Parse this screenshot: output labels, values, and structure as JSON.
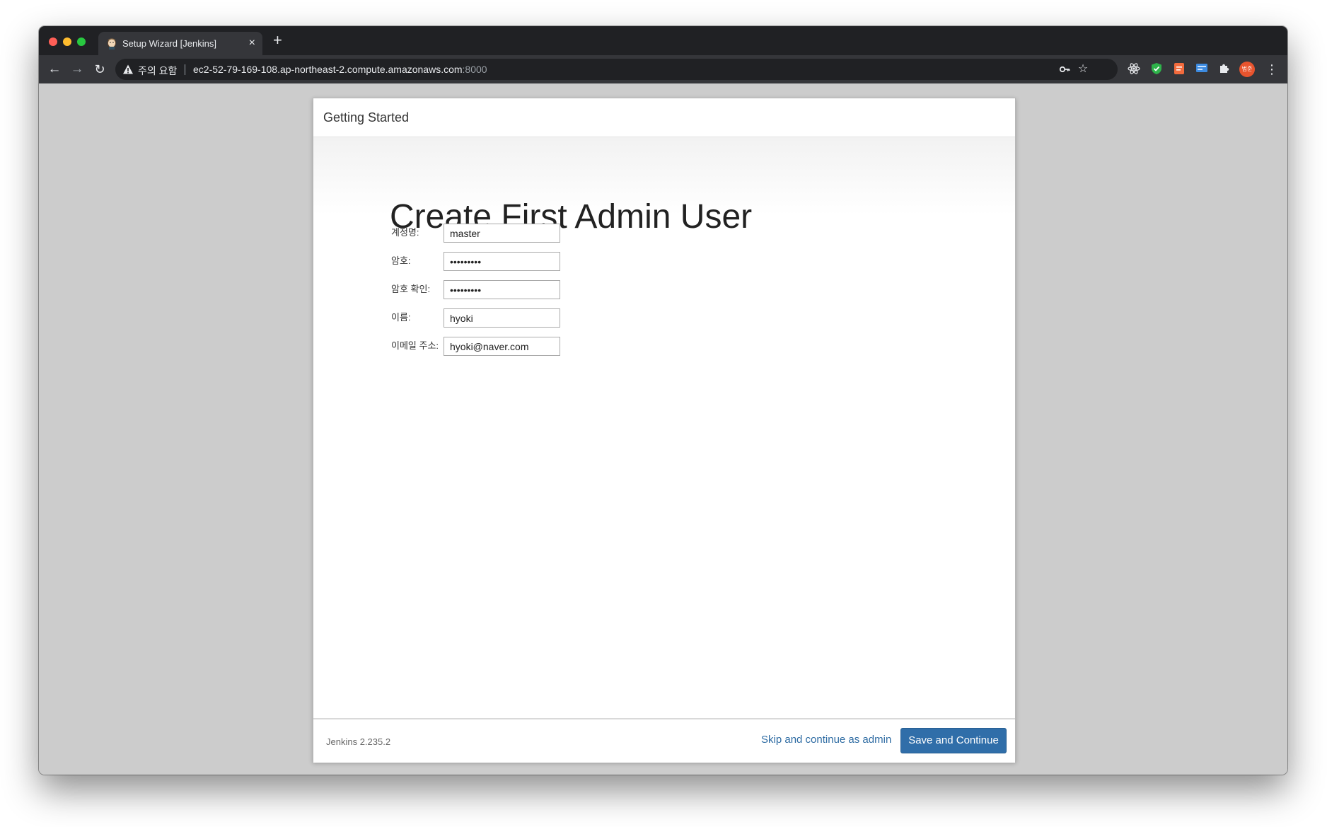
{
  "browser": {
    "tab": {
      "title": "Setup Wizard [Jenkins]",
      "close_glyph": "×"
    },
    "new_tab_glyph": "+",
    "nav": {
      "back_glyph": "←",
      "forward_glyph": "→",
      "reload_glyph": "↻"
    },
    "security_warning": "주의 요함",
    "url_host": "ec2-52-79-169-108.ap-northeast-2.compute.amazonaws.com",
    "url_port": ":8000",
    "profile_avatar_text": "범준",
    "icons": [
      "key-icon",
      "star-icon",
      "react-devtools-icon",
      "shield-check-icon",
      "ext-pdf-icon",
      "ext-card-icon",
      "puzzle-icon",
      "kebab-menu-icon"
    ]
  },
  "dialog": {
    "header_title": "Getting Started",
    "heading": "Create First Admin User",
    "fields": [
      {
        "label": "계정명:",
        "value": "master",
        "type": "text"
      },
      {
        "label": "암호:",
        "value": "•••••••••",
        "type": "password"
      },
      {
        "label": "암호 확인:",
        "value": "•••••••••",
        "type": "password"
      },
      {
        "label": "이름:",
        "value": "hyoki",
        "type": "text"
      },
      {
        "label": "이메일 주소:",
        "value": "hyoki@naver.com",
        "type": "text"
      }
    ],
    "footer": {
      "version": "Jenkins 2.235.2",
      "skip_label": "Skip and continue as admin",
      "save_label": "Save and Continue"
    }
  },
  "colors": {
    "primary_button": "#306ea9",
    "link": "#2f6ca3",
    "page_background": "#cccccc"
  }
}
